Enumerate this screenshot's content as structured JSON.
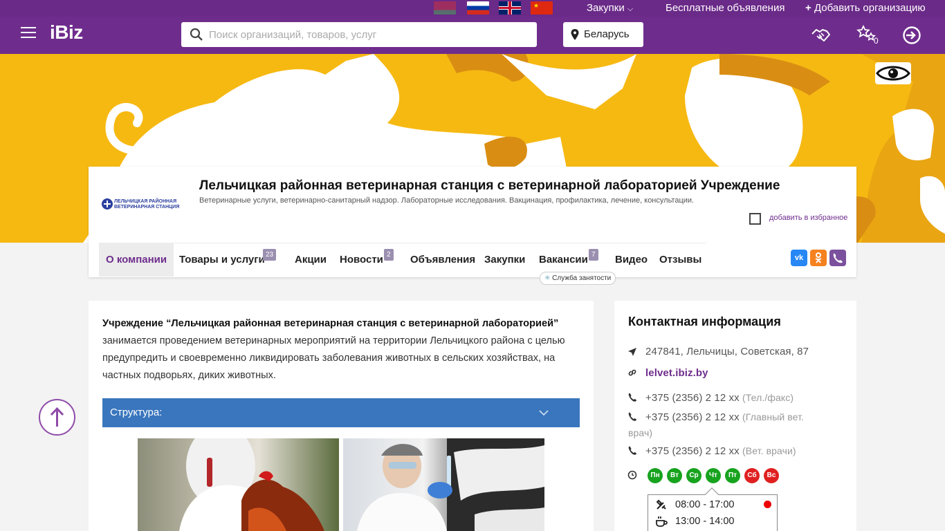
{
  "topbar": {
    "flags": [
      "Беларусь",
      "Русский",
      "English",
      "中文"
    ],
    "zakupki": "Закупки",
    "free_ads": "Бесплатные объявления",
    "add_org": "Добавить организацию"
  },
  "header": {
    "logo": "iBiz",
    "search_placeholder": "Поиск организаций, товаров, услуг",
    "region": "Беларусь",
    "favorites_count": "0"
  },
  "company": {
    "logo_text_1": "ЛЕЛЬЧИЦКАЯ РАЙОННАЯ",
    "logo_text_2": "ВЕТЕРИНАРНАЯ СТАНЦИЯ",
    "title": "Лельчицкая районная ветеринарная станция с ветеринарной лабораторией Учреждение",
    "subtitle": "Ветеринарные услуги, ветеринарно-санитарный надзор. Лабораторные исследования. Вакцинация, профилактика, лечение, консультации.",
    "favorite_label": "добавить в избранное"
  },
  "tabs": [
    {
      "label": "О компании"
    },
    {
      "label": "Товары и услуги",
      "count": "23"
    },
    {
      "label": "Акции"
    },
    {
      "label": "Новости",
      "count": "2"
    },
    {
      "label": "Объявления"
    },
    {
      "label": "Закупки"
    },
    {
      "label": "Вакансии",
      "count": "7"
    },
    {
      "label": "Видео"
    },
    {
      "label": "Отзывы"
    }
  ],
  "jobs_badge": "Служба занятости",
  "social": {
    "vk": "VK",
    "ok": "ok",
    "viber": "viber"
  },
  "about": {
    "bold": "Учреждение “Лельчицкая районная ветеринарная станция с ветеринарной лабораторией”",
    "text": " занимается проведением ветеринарных мероприятий на территории Лельчицкого района с целью предупредить и своевременно ликвидировать заболевания животных в сельских хозяйствах, на частных подворьях, диких животных."
  },
  "accordion": {
    "label": "Структура:"
  },
  "contacts": {
    "title": "Контактная информация",
    "address": "247841, Лельчицы, Советская, 87",
    "site": "lelvet.ibiz.by",
    "phones": [
      {
        "number": "+375 (2356) 2 12 xx",
        "note": "(Тел./факс)"
      },
      {
        "number": "+375 (2356) 2 12 xx",
        "note": "(Главный вет.",
        "note2": "врач)"
      },
      {
        "number": "+375 (2356) 2 12 xx",
        "note": "(Вет. врачи)"
      }
    ],
    "days": [
      {
        "label": "Пн",
        "status": "work"
      },
      {
        "label": "Вт",
        "status": "work"
      },
      {
        "label": "Ср",
        "status": "work"
      },
      {
        "label": "Чт",
        "status": "work"
      },
      {
        "label": "Пт",
        "status": "work"
      },
      {
        "label": "Сб",
        "status": "off"
      },
      {
        "label": "Вс",
        "status": "off"
      }
    ],
    "work_hours": "08:00 - 17:00",
    "lunch_hours": "13:00 - 14:00"
  },
  "colors": {
    "brand": "#6e2d8c",
    "banner": "#f6b912",
    "accordion": "#3a76bd",
    "open": "#18a31f",
    "closed": "#e02020"
  }
}
